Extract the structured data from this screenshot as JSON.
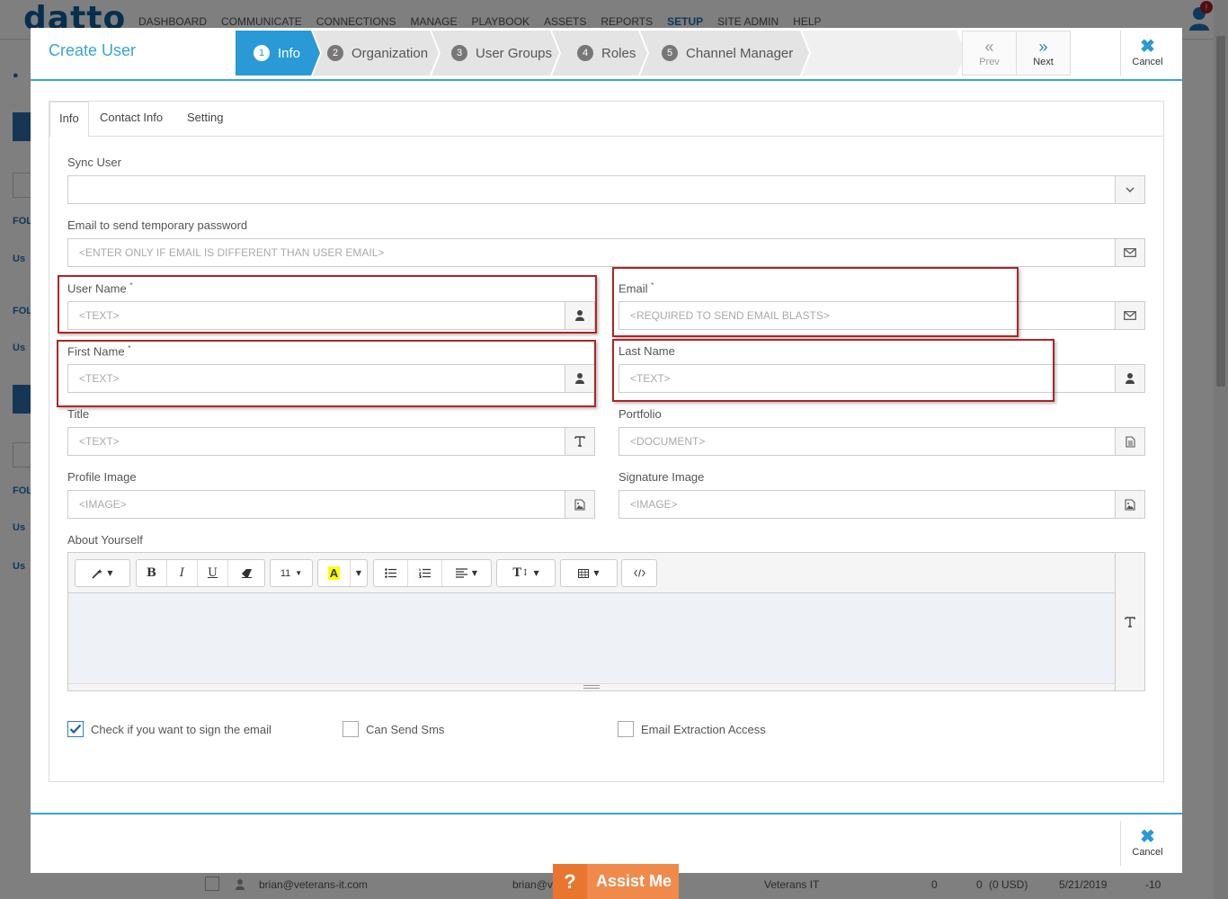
{
  "background": {
    "logo": "datto",
    "nav": [
      "DASHBOARD",
      "COMMUNICATE",
      "CONNECTIONS",
      "MANAGE",
      "PLAYBOOK",
      "ASSETS",
      "REPORTS",
      "SETUP",
      "SITE ADMIN",
      "HELP"
    ],
    "nav_active": "SETUP",
    "notification_count": "!",
    "side_labels": [
      "FOL",
      "Us",
      "FOL",
      "Us",
      "FOL",
      "Us",
      "Us"
    ],
    "row": {
      "username": "brian@veterans-it.com",
      "email": "brian@v",
      "org": "Veterans IT",
      "c1": "0",
      "c2": "0",
      "amount": "(0 USD)",
      "date": "5/21/2019",
      "last": "-10"
    }
  },
  "modal": {
    "title": "Create User",
    "steps": [
      {
        "num": "1",
        "label": "Info"
      },
      {
        "num": "2",
        "label": "Organization"
      },
      {
        "num": "3",
        "label": "User Groups"
      },
      {
        "num": "4",
        "label": "Roles"
      },
      {
        "num": "5",
        "label": "Channel Manager"
      }
    ],
    "prev_label": "Prev",
    "next_label": "Next",
    "cancel_label": "Cancel"
  },
  "tabs": [
    "Info",
    "Contact Info",
    "Setting"
  ],
  "form": {
    "sync_user": {
      "label": "Sync User",
      "value": ""
    },
    "temp_email": {
      "label": "Email to send temporary password",
      "placeholder": "<ENTER ONLY IF EMAIL IS DIFFERENT THAN USER EMAIL>"
    },
    "user_name": {
      "label": "User Name",
      "placeholder": "<TEXT>"
    },
    "email": {
      "label": "Email",
      "placeholder": "<REQUIRED TO SEND EMAIL BLASTS>"
    },
    "first_name": {
      "label": "First Name",
      "placeholder": "<TEXT>"
    },
    "last_name": {
      "label": "Last Name",
      "placeholder": "<TEXT>"
    },
    "title": {
      "label": "Title",
      "placeholder": "<TEXT>"
    },
    "portfolio": {
      "label": "Portfolio",
      "placeholder": "<DOCUMENT>"
    },
    "profile_image": {
      "label": "Profile Image",
      "placeholder": "<IMAGE>"
    },
    "signature_image": {
      "label": "Signature Image",
      "placeholder": "<IMAGE>"
    },
    "about": {
      "label": "About Yourself",
      "font_size": "11"
    },
    "required_mark": "*"
  },
  "checkboxes": [
    {
      "label": "Check if you want to sign the email",
      "checked": true
    },
    {
      "label": "Can Send Sms",
      "checked": false
    },
    {
      "label": "Email Extraction Access",
      "checked": false
    }
  ],
  "assist": {
    "icon": "?",
    "label": "Assist Me"
  },
  "colors": {
    "accent": "#2a9ad6",
    "highlight_box": "#b02424",
    "assist": "#f08a4b"
  }
}
